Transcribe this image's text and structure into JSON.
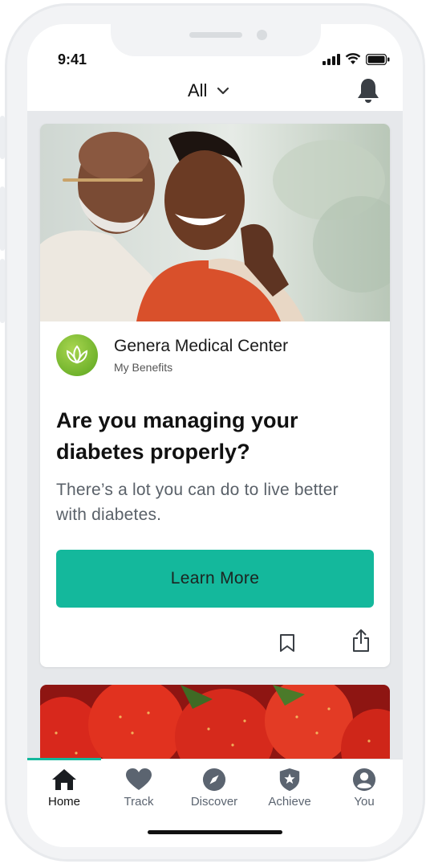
{
  "status_bar": {
    "time": "9:41"
  },
  "header": {
    "filter_label": "All"
  },
  "card": {
    "org_name": "Genera Medical Center",
    "org_subtitle": "My Benefits",
    "title": "Are you managing your diabetes properly?",
    "body": "There’s a lot you can do to live better with diabetes.",
    "cta_label": "Learn More"
  },
  "tabs": [
    {
      "label": "Home",
      "icon": "home-icon",
      "active": true
    },
    {
      "label": "Track",
      "icon": "heart-icon",
      "active": false
    },
    {
      "label": "Discover",
      "icon": "compass-icon",
      "active": false
    },
    {
      "label": "Achieve",
      "icon": "star-shield-icon",
      "active": false
    },
    {
      "label": "You",
      "icon": "user-icon",
      "active": false
    }
  ],
  "colors": {
    "accent": "#14b89c",
    "feed_bg": "#e6e8eb",
    "logo_green": "#6cb52b"
  }
}
